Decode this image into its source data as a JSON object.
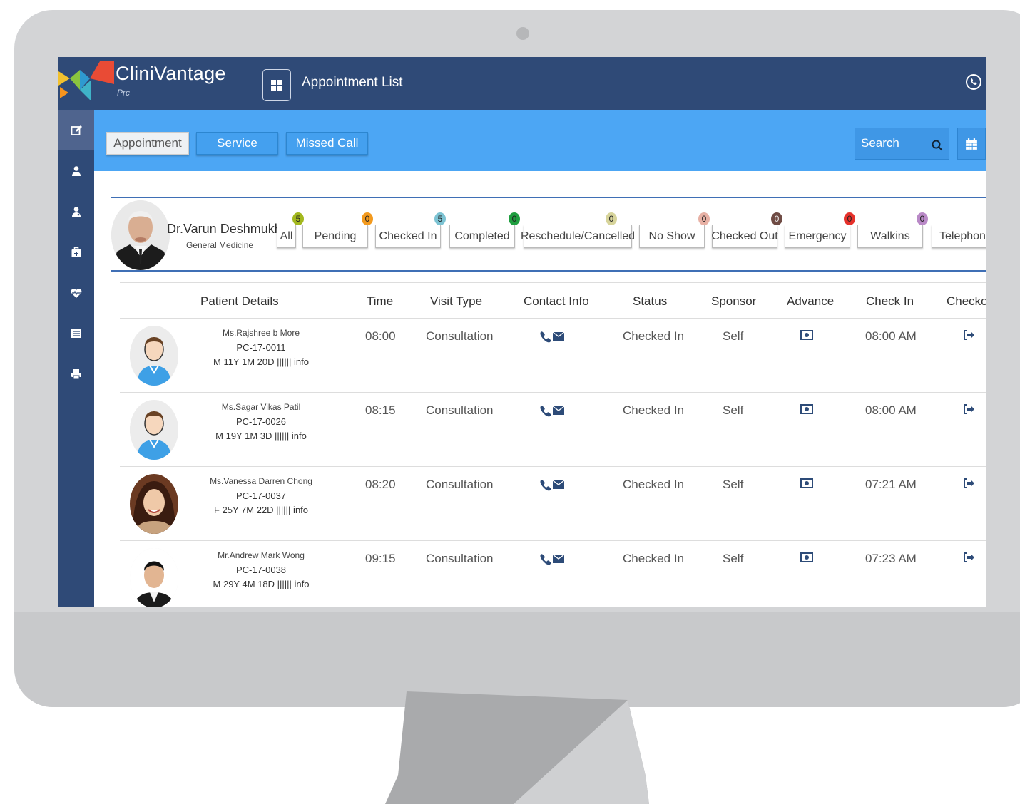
{
  "app": {
    "brand": "CliniVantage",
    "brand_sub": "Prc",
    "page_title": "Appointment List"
  },
  "tabs": [
    {
      "label": "Appointment",
      "active": true
    },
    {
      "label": "Service",
      "active": false
    },
    {
      "label": "Missed Call",
      "active": false
    }
  ],
  "search": {
    "placeholder": "Search"
  },
  "doctor": {
    "name": "Dr.Varun Deshmukh",
    "specialty": "General Medicine"
  },
  "filters": [
    {
      "label": "All",
      "count": "5",
      "color": "#a3b81e"
    },
    {
      "label": "Pending",
      "count": "0",
      "color": "#f39a1e"
    },
    {
      "label": "Checked In",
      "count": "5",
      "color": "#7cc3d3"
    },
    {
      "label": "Completed",
      "count": "0",
      "color": "#1f9e3f"
    },
    {
      "label": "Reschedule/Cancelled",
      "count": "0",
      "color": "#d7d49b"
    },
    {
      "label": "No Show",
      "count": "0",
      "color": "#e8b1a5"
    },
    {
      "label": "Checked Out",
      "count": "0",
      "color": "#6f4b44"
    },
    {
      "label": "Emergency",
      "count": "0",
      "color": "#e6312b"
    },
    {
      "label": "Walkins",
      "count": "0",
      "color": "#b989c7"
    },
    {
      "label": "Telephonic",
      "count": "",
      "color": "#f3c37a"
    }
  ],
  "columns": [
    "Patient Details",
    "Time",
    "Visit Type",
    "Contact Info",
    "Status",
    "Sponsor",
    "Advance",
    "Check In",
    "Checkout"
  ],
  "rows": [
    {
      "name": "Ms.Rajshree b More",
      "pid": "PC-17-0011",
      "meta": "M 11Y 1M 20D  ||||||  info",
      "time": "08:00",
      "visit": "Consultation",
      "status": "Checked In",
      "sponsor": "Self",
      "checkin": "08:00 AM",
      "avatar": "male-avatar"
    },
    {
      "name": "Ms.Sagar Vikas Patil",
      "pid": "PC-17-0026",
      "meta": "M 19Y 1M 3D  ||||||  info",
      "time": "08:15",
      "visit": "Consultation",
      "status": "Checked In",
      "sponsor": "Self",
      "checkin": "08:00 AM",
      "avatar": "male-avatar"
    },
    {
      "name": "Ms.Vanessa Darren Chong",
      "pid": "PC-17-0037",
      "meta": "F 25Y 7M 22D  ||||||  info",
      "time": "08:20",
      "visit": "Consultation",
      "status": "Checked In",
      "sponsor": "Self",
      "checkin": "07:21 AM",
      "avatar": "female-photo"
    },
    {
      "name": "Mr.Andrew Mark Wong",
      "pid": "PC-17-0038",
      "meta": "M 29Y 4M 18D  ||||||  info",
      "time": "09:15",
      "visit": "Consultation",
      "status": "Checked In",
      "sponsor": "Self",
      "checkin": "07:23 AM",
      "avatar": "male-photo"
    }
  ],
  "colors": {
    "topbar": "#2f4a77",
    "bluebar": "#4ca6f4",
    "accent_line": "#3f6fb5"
  },
  "sidebar_icons": [
    "edit-icon",
    "user-icon",
    "doctor-icon",
    "medkit-icon",
    "heartbeat-icon",
    "list-icon",
    "print-icon"
  ]
}
